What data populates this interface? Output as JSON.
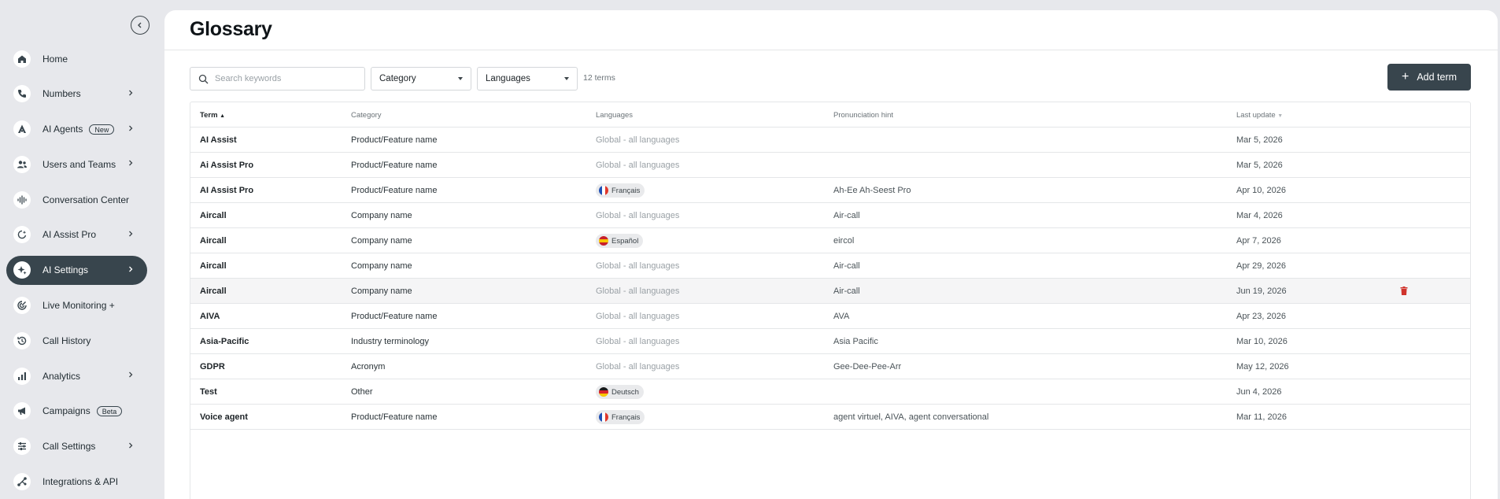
{
  "sidebar": {
    "collapse_icon": "chevron-left-icon",
    "items": [
      {
        "label": "Home",
        "icon": "home-icon",
        "chevron": false,
        "badge": ""
      },
      {
        "label": "Numbers",
        "icon": "phone-icon",
        "chevron": true,
        "badge": ""
      },
      {
        "label": "AI Agents",
        "icon": "robot-icon",
        "chevron": true,
        "badge": "New"
      },
      {
        "label": "Users and Teams",
        "icon": "users-icon",
        "chevron": true,
        "badge": ""
      },
      {
        "label": "Conversation Center",
        "icon": "waveform-icon",
        "chevron": false,
        "badge": ""
      },
      {
        "label": "AI Assist Pro",
        "icon": "sparkle-refresh-icon",
        "chevron": true,
        "badge": ""
      },
      {
        "label": "AI Settings",
        "icon": "sparkles-icon",
        "chevron": true,
        "badge": "",
        "active": true
      },
      {
        "label": "Live Monitoring +",
        "icon": "monitoring-icon",
        "chevron": false,
        "badge": ""
      },
      {
        "label": "Call History",
        "icon": "history-icon",
        "chevron": false,
        "badge": ""
      },
      {
        "label": "Analytics",
        "icon": "bar-chart-icon",
        "chevron": true,
        "badge": ""
      },
      {
        "label": "Campaigns",
        "icon": "megaphone-icon",
        "chevron": false,
        "badge": "Beta"
      },
      {
        "label": "Call Settings",
        "icon": "sliders-icon",
        "chevron": true,
        "badge": ""
      },
      {
        "label": "Integrations & API",
        "icon": "share-nodes-icon",
        "chevron": false,
        "badge": ""
      }
    ]
  },
  "page": {
    "title": "Glossary"
  },
  "toolbar": {
    "search_placeholder": "Search keywords",
    "category_label": "Category",
    "languages_label": "Languages",
    "count": "12 terms",
    "add_label": "Add term"
  },
  "table": {
    "headers": {
      "term": "Term",
      "category": "Category",
      "languages": "Languages",
      "hint": "Pronunciation hint",
      "date": "Last update"
    },
    "rows": [
      {
        "term": "AI Assist",
        "category": "Product/Feature name",
        "language": "Global - all languages",
        "flag": "",
        "hint": "",
        "date": "Mar 5, 2026"
      },
      {
        "term": "Ai Assist Pro",
        "category": "Product/Feature name",
        "language": "Global - all languages",
        "flag": "",
        "hint": "",
        "date": "Mar 5, 2026"
      },
      {
        "term": "AI Assist Pro",
        "category": "Product/Feature name",
        "language": "Français",
        "flag": "fr",
        "hint": "Ah-Ee Ah-Seest Pro",
        "date": "Apr 10, 2026"
      },
      {
        "term": "Aircall",
        "category": "Company name",
        "language": "Global - all languages",
        "flag": "",
        "hint": "Air-call",
        "date": "Mar 4, 2026"
      },
      {
        "term": "Aircall",
        "category": "Company name",
        "language": "Español",
        "flag": "es",
        "hint": "eircol",
        "date": "Apr 7, 2026"
      },
      {
        "term": "Aircall",
        "category": "Company name",
        "language": "Global - all languages",
        "flag": "",
        "hint": "Air-call",
        "date": "Apr 29, 2026"
      },
      {
        "term": "Aircall",
        "category": "Company name",
        "language": "Global - all languages",
        "flag": "",
        "hint": "Air-call",
        "date": "Jun 19, 2026",
        "hover": true
      },
      {
        "term": "AIVA",
        "category": "Product/Feature name",
        "language": "Global - all languages",
        "flag": "",
        "hint": "AVA",
        "date": "Apr 23, 2026"
      },
      {
        "term": "Asia-Pacific",
        "category": "Industry terminology",
        "language": "Global - all languages",
        "flag": "",
        "hint": "Asia Pacific",
        "date": "Mar 10, 2026"
      },
      {
        "term": "GDPR",
        "category": "Acronym",
        "language": "Global - all languages",
        "flag": "",
        "hint": "Gee-Dee-Pee-Arr",
        "date": "May 12, 2026"
      },
      {
        "term": "Test",
        "category": "Other",
        "language": "Deutsch",
        "flag": "de",
        "hint": "",
        "date": "Jun 4, 2026"
      },
      {
        "term": "Voice agent",
        "category": "Product/Feature name",
        "language": "Français",
        "flag": "fr",
        "hint": "agent virtuel, AIVA, agent conversational",
        "date": "Mar 11, 2026"
      }
    ]
  },
  "colors": {
    "accent": "#38454d",
    "delete": "#d0342c"
  }
}
